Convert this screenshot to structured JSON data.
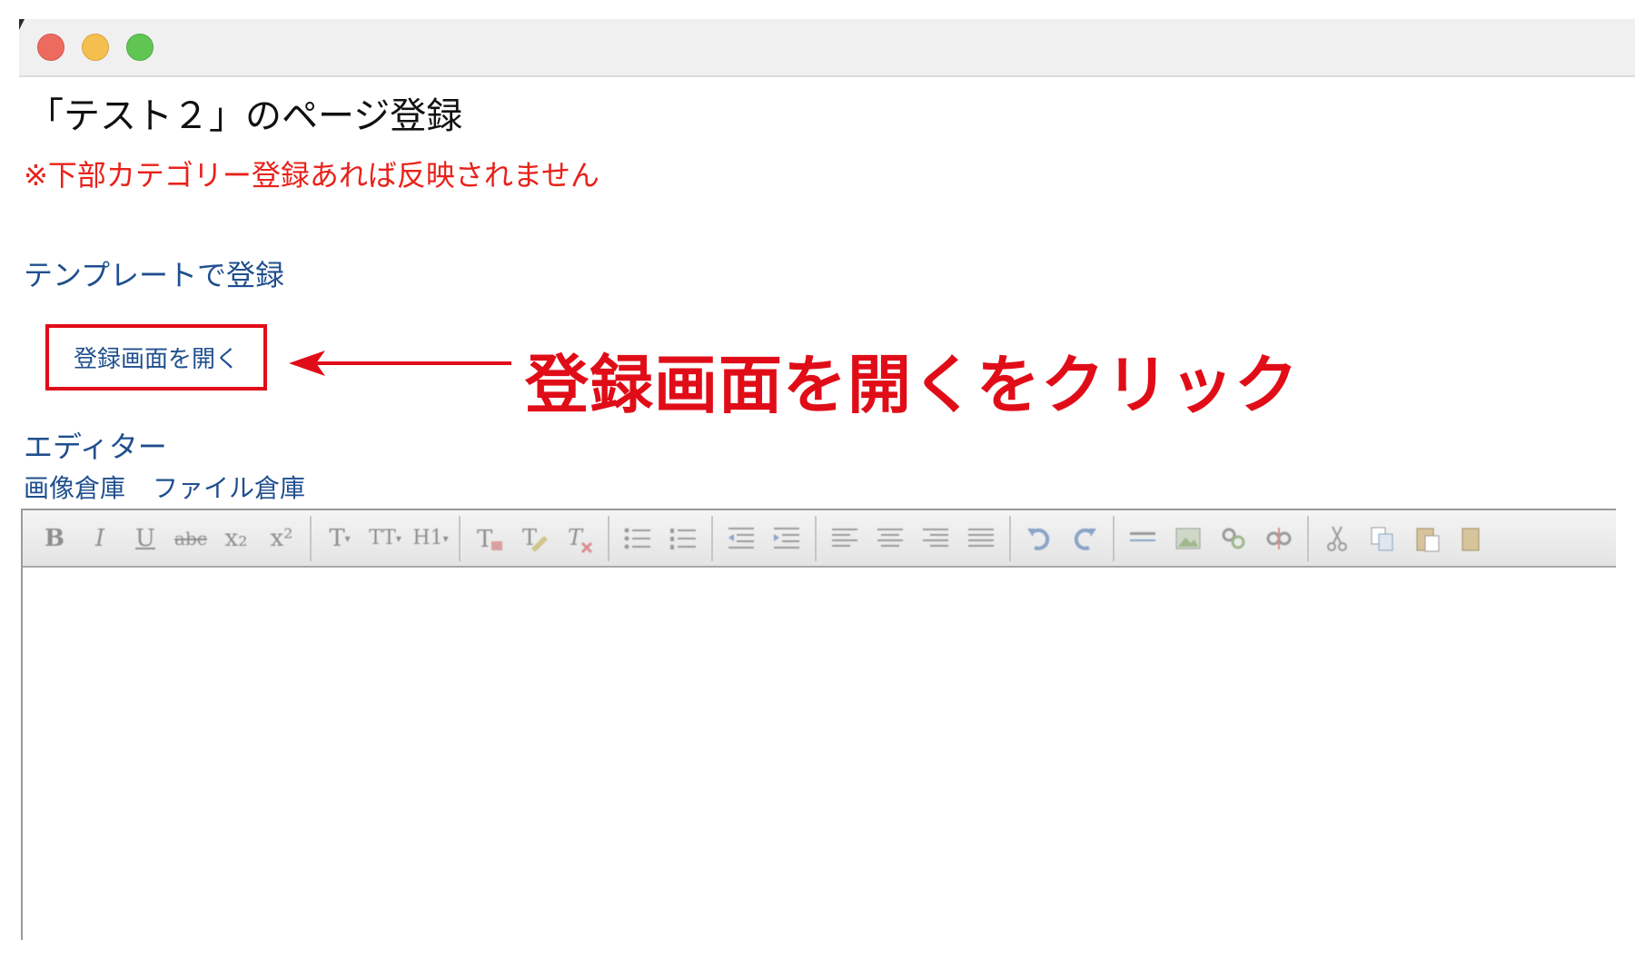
{
  "window": {
    "controls": {
      "close": "close-light",
      "minimize": "minimize-light",
      "zoom": "zoom-light"
    }
  },
  "page": {
    "title": "「テスト２」のページ登録",
    "warning": "※下部カテゴリー登録あれば反映されません",
    "template_link": "テンプレートで登録",
    "open_button": "登録画面を開く",
    "annotation": "登録画面を開くをクリック",
    "editor_label": "エディター",
    "image_storage": "画像倉庫",
    "file_storage": "ファイル倉庫"
  },
  "toolbar": {
    "bold": "B",
    "italic": "I",
    "underline": "U",
    "strike": "abc",
    "subscript": "x₂",
    "superscript": "x²",
    "font": "T",
    "font_size": "TT",
    "heading": "H1"
  },
  "colors": {
    "accent_red": "#e00d18",
    "link_blue": "#1f4f8e",
    "warning_red": "#e8221a"
  }
}
